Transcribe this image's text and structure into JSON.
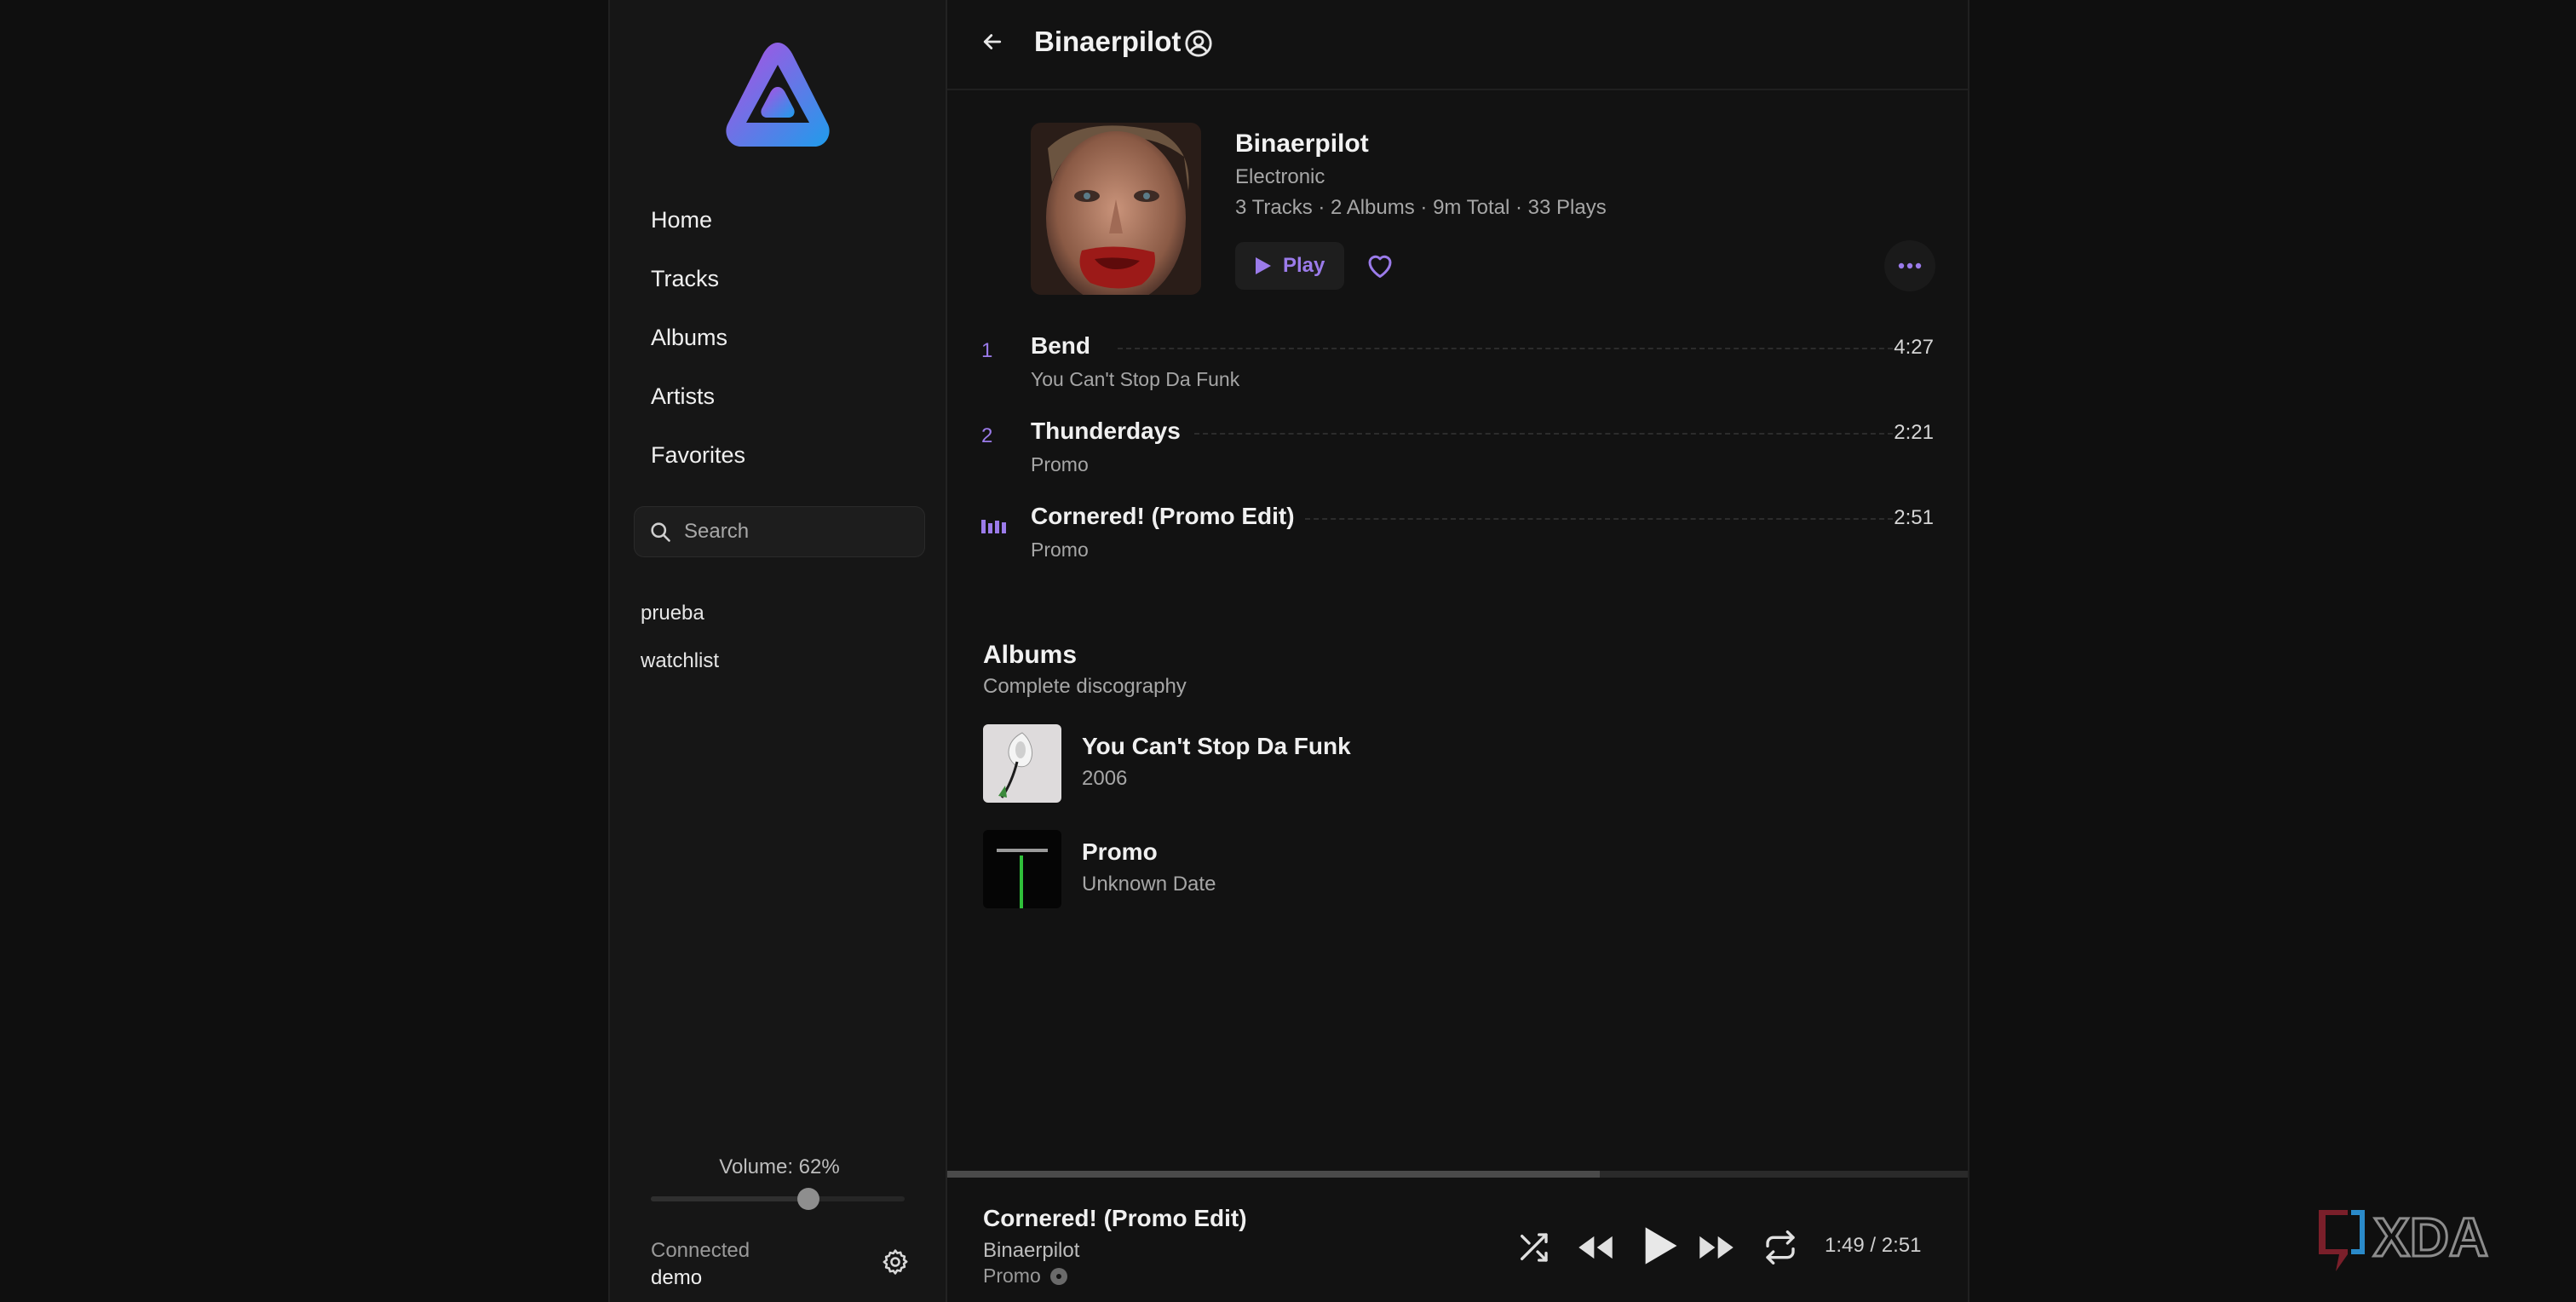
{
  "sidebar": {
    "nav": [
      "Home",
      "Tracks",
      "Albums",
      "Artists",
      "Favorites"
    ],
    "search_placeholder": "Search",
    "playlists": [
      "prueba",
      "watchlist"
    ],
    "volume_label": "Volume: 62%",
    "volume_value": 0.62,
    "connection_label": "Connected",
    "connection_user": "demo"
  },
  "header": {
    "title": "Binaerpilot"
  },
  "artist": {
    "name": "Binaerpilot",
    "genre": "Electronic",
    "stats": "3 Tracks · 2 Albums · 9m Total · 33 Plays",
    "play_label": "Play"
  },
  "tracks": [
    {
      "num": "1",
      "title": "Bend",
      "album": "You Can't Stop Da Funk",
      "duration": "4:27",
      "playing": false
    },
    {
      "num": "2",
      "title": "Thunderdays",
      "album": "Promo",
      "duration": "2:21",
      "playing": false
    },
    {
      "num": "",
      "title": "Cornered! (Promo Edit)",
      "album": "Promo",
      "duration": "2:51",
      "playing": true
    }
  ],
  "albums_section": {
    "title": "Albums",
    "subtitle": "Complete discography",
    "items": [
      {
        "name": "You Can't Stop Da Funk",
        "year": "2006"
      },
      {
        "name": "Promo",
        "year": "Unknown Date"
      }
    ]
  },
  "player": {
    "title": "Cornered! (Promo Edit)",
    "artist": "Binaerpilot",
    "album": "Promo",
    "current_time": "1:49",
    "separator": "/",
    "total_time": "2:51",
    "progress": 0.639
  },
  "watermark": "XDA",
  "colors": {
    "accent": "#9b7bea",
    "background": "#121212",
    "sidebar": "#161616"
  }
}
